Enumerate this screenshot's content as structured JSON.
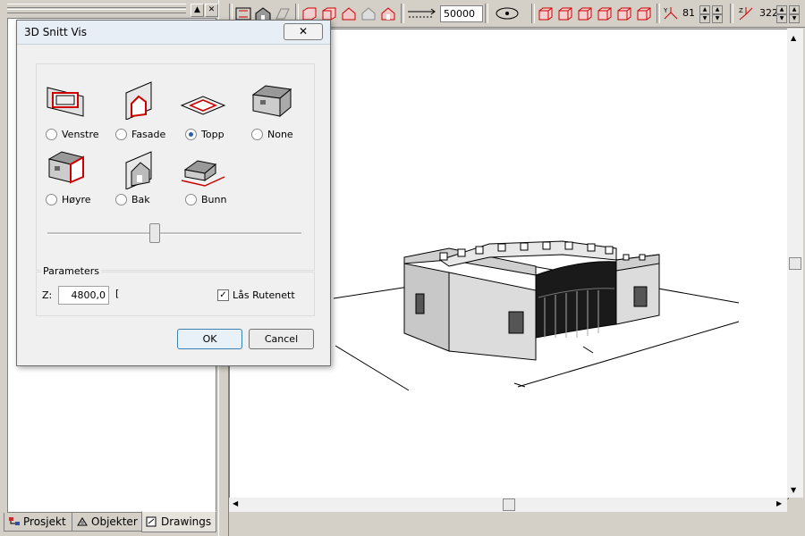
{
  "toolbar": {
    "distance_value": "50000",
    "angle1_value": "81",
    "angle2_value": "322"
  },
  "left_tabs": [
    {
      "label": "Prosjekt"
    },
    {
      "label": "Objekter"
    },
    {
      "label": "Drawings"
    }
  ],
  "dialog": {
    "title": "3D Snitt Vis",
    "close_label": "✕",
    "options": [
      {
        "label": "Venstre",
        "checked": false,
        "icon": "left-section-icon"
      },
      {
        "label": "Fasade",
        "checked": false,
        "icon": "facade-section-icon"
      },
      {
        "label": "Topp",
        "checked": true,
        "icon": "top-section-icon"
      },
      {
        "label": "None",
        "checked": false,
        "icon": "house-icon"
      },
      {
        "label": "Høyre",
        "checked": false,
        "icon": "right-section-icon"
      },
      {
        "label": "Bak",
        "checked": false,
        "icon": "back-section-icon"
      },
      {
        "label": "Bunn",
        "checked": false,
        "icon": "bottom-section-icon"
      }
    ],
    "slider_fraction": 0.42,
    "params_legend": "Parameters",
    "z_label": "Z:",
    "z_value": "4800,0",
    "z_suffix": "[",
    "lock_grid_label": "Lås Rutenett",
    "lock_grid_checked": true,
    "ok_label": "OK",
    "cancel_label": "Cancel"
  }
}
